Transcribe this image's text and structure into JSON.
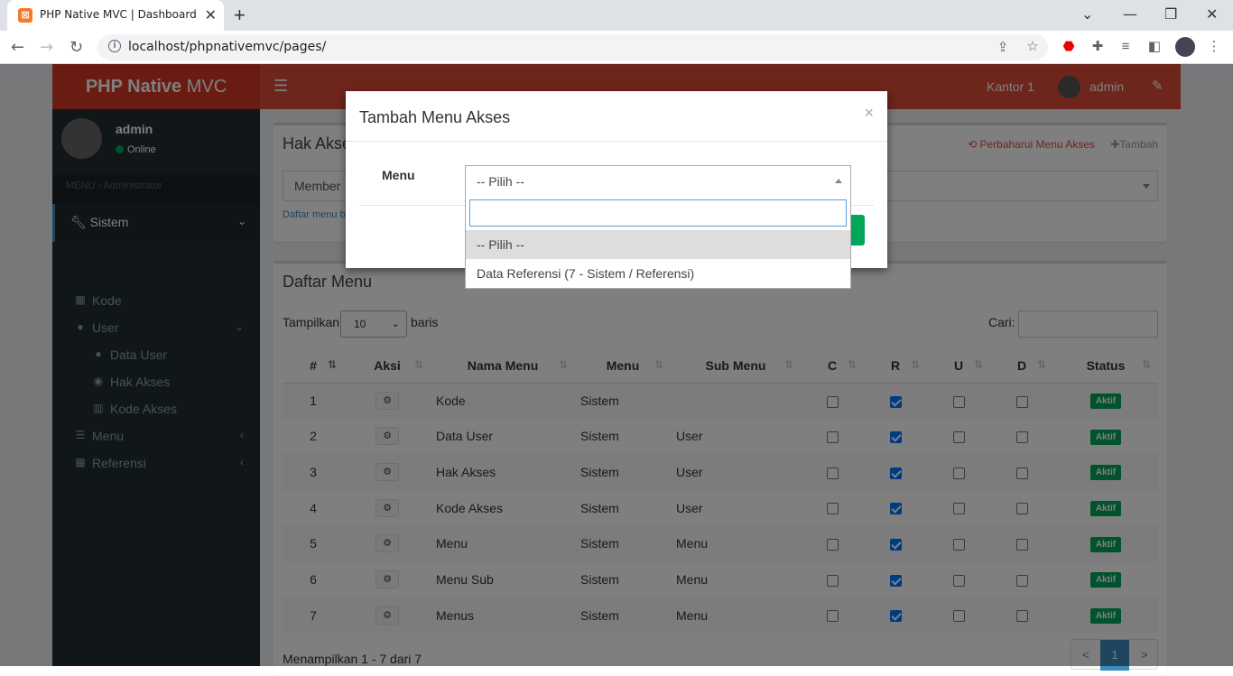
{
  "browser": {
    "tab_title": "PHP Native MVC | Dashboard",
    "url": "localhost/phpnativemvc/pages/"
  },
  "app": {
    "logo_bold": "PHP Native",
    "logo_light": " MVC",
    "office": "Kantor 1",
    "username": "admin"
  },
  "sidebar": {
    "user": "admin",
    "status": "Online",
    "header": "MENU - Administrator",
    "section": "Sistem",
    "items": [
      {
        "label": "Kode",
        "level": 1
      },
      {
        "label": "User",
        "level": 1
      },
      {
        "label": "Data User",
        "level": 2
      },
      {
        "label": "Hak Akses",
        "level": 2
      },
      {
        "label": "Kode Akses",
        "level": 2
      },
      {
        "label": "Menu",
        "level": 1
      },
      {
        "label": "Referensi",
        "level": 1
      }
    ]
  },
  "hak_akses": {
    "title": "Hak Akses",
    "refresh_label": "Perbaharui Menu Akses",
    "add_label": "Tambah",
    "role_value": "Member",
    "hint": "Daftar menu b"
  },
  "daftar_menu": {
    "title": "Daftar Menu",
    "show_label": "Tampilkan",
    "show_value": "10",
    "rows_label": "baris",
    "search_label": "Cari:",
    "columns": [
      "#",
      "Aksi",
      "Nama Menu",
      "Menu",
      "Sub Menu",
      "C",
      "R",
      "U",
      "D",
      "Status"
    ],
    "rows": [
      {
        "no": "1",
        "nama": "Kode",
        "menu": "Sistem",
        "sub": "",
        "c": false,
        "r": true,
        "u": false,
        "d": false,
        "status": "Aktif"
      },
      {
        "no": "2",
        "nama": "Data User",
        "menu": "Sistem",
        "sub": "User",
        "c": false,
        "r": true,
        "u": false,
        "d": false,
        "status": "Aktif"
      },
      {
        "no": "3",
        "nama": "Hak Akses",
        "menu": "Sistem",
        "sub": "User",
        "c": false,
        "r": true,
        "u": false,
        "d": false,
        "status": "Aktif"
      },
      {
        "no": "4",
        "nama": "Kode Akses",
        "menu": "Sistem",
        "sub": "User",
        "c": false,
        "r": true,
        "u": false,
        "d": false,
        "status": "Aktif"
      },
      {
        "no": "5",
        "nama": "Menu",
        "menu": "Sistem",
        "sub": "Menu",
        "c": false,
        "r": true,
        "u": false,
        "d": false,
        "status": "Aktif"
      },
      {
        "no": "6",
        "nama": "Menu Sub",
        "menu": "Sistem",
        "sub": "Menu",
        "c": false,
        "r": true,
        "u": false,
        "d": false,
        "status": "Aktif"
      },
      {
        "no": "7",
        "nama": "Menus",
        "menu": "Sistem",
        "sub": "Menu",
        "c": false,
        "r": true,
        "u": false,
        "d": false,
        "status": "Aktif"
      }
    ],
    "info": "Menampilkan 1 - 7 dari 7",
    "pager": {
      "prev": "<",
      "current": "1",
      "next": ">"
    }
  },
  "modal": {
    "title": "Tambah Menu Akses",
    "close": "×",
    "field_label": "Menu",
    "selected": "-- Pilih --",
    "options": [
      "-- Pilih --",
      "Data Referensi (7 - Sistem / Referensi)"
    ]
  },
  "colors": {
    "header": "#dd4b39",
    "sidebar": "#222d32",
    "success": "#00a65a",
    "primary": "#3c8dbc"
  }
}
